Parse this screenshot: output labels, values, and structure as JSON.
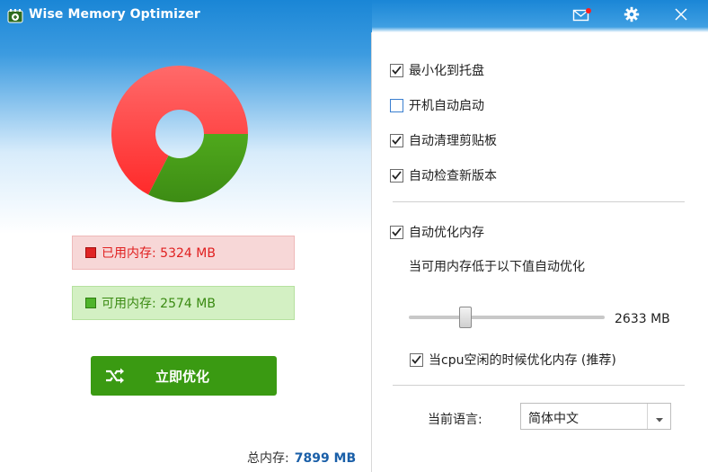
{
  "app": {
    "title": "Wise Memory Optimizer",
    "icons": [
      "app-logo-icon",
      "mail-icon",
      "gear-icon",
      "close-icon"
    ]
  },
  "memory": {
    "used_label": "已用内存: 5324 MB",
    "free_label": "可用内存: 2574 MB",
    "used_mb": 5324,
    "free_mb": 2574,
    "total_label": "总内存:",
    "total_value": "7899 MB",
    "used_color": "#ff3030",
    "free_color": "#4aa01c"
  },
  "optimize_button": {
    "label": "立即优化",
    "icon": "shuffle-icon"
  },
  "settings": {
    "minimize_to_tray": {
      "label": "最小化到托盘",
      "checked": true
    },
    "start_on_boot": {
      "label": "开机自动启动",
      "checked": false
    },
    "auto_clear_clipboard": {
      "label": "自动清理剪贴板",
      "checked": true
    },
    "auto_check_update": {
      "label": "自动检查新版本",
      "checked": true
    },
    "auto_optimize": {
      "label": "自动优化内存",
      "checked": true
    },
    "threshold_text": "当可用内存低于以下值自动优化",
    "threshold_value": "2633 MB",
    "threshold_fraction": 0.29,
    "cpu_idle_optimize": {
      "label": "当cpu空闲的时候优化内存 (推荐)",
      "checked": true
    },
    "language_label": "当前语言:",
    "language_value": "简体中文"
  }
}
